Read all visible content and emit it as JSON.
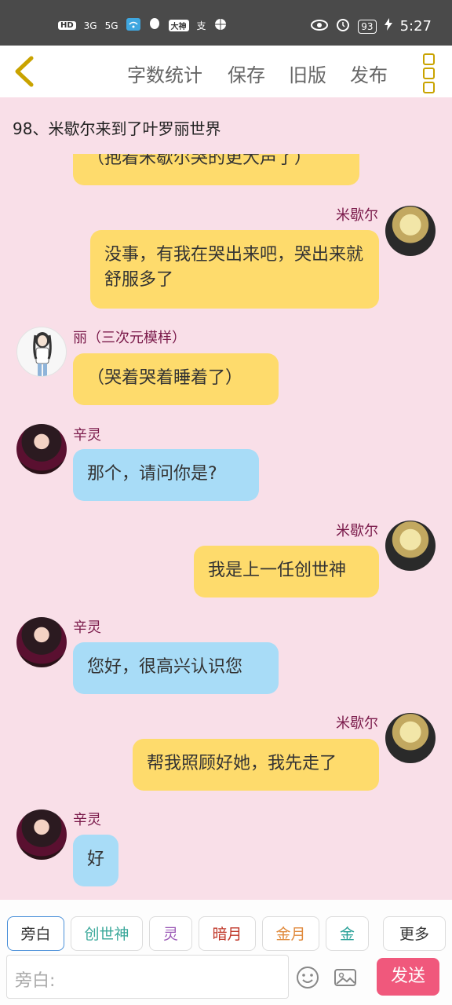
{
  "statusbar": {
    "left_labels": [
      "HD",
      "3G",
      "5G",
      "大神",
      "支"
    ],
    "battery": "93",
    "time": "5:27"
  },
  "topbar": {
    "nav": [
      "字数统计",
      "保存",
      "旧版",
      "发布"
    ]
  },
  "chapter_title": "98、米歇尔来到了叶罗丽世界",
  "messages": [
    {
      "side": "left",
      "speaker": "",
      "text": "（抱着米歇尔哭的更大声了）",
      "color": "yellow"
    },
    {
      "side": "right",
      "speaker": "米歇尔",
      "text": "没事，有我在哭出来吧，哭出来就舒服多了",
      "color": "yellow"
    },
    {
      "side": "left",
      "speaker": "丽（三次元模样）",
      "text": "（哭着哭着睡着了）",
      "color": "yellow"
    },
    {
      "side": "left",
      "speaker": "辛灵",
      "text": "那个，请问你是?",
      "color": "blue"
    },
    {
      "side": "right",
      "speaker": "米歇尔",
      "text": "我是上一任创世神",
      "color": "yellow"
    },
    {
      "side": "left",
      "speaker": "辛灵",
      "text": "您好，很高兴认识您",
      "color": "blue"
    },
    {
      "side": "right",
      "speaker": "米歇尔",
      "text": "帮我照顾好她，我先走了",
      "color": "yellow"
    },
    {
      "side": "left",
      "speaker": "辛灵",
      "text": "好",
      "color": "blue"
    }
  ],
  "roles": [
    {
      "label": "旁白",
      "color": "#333333"
    },
    {
      "label": "创世神",
      "color": "#3aa89a"
    },
    {
      "label": "灵",
      "color": "#9b59b6"
    },
    {
      "label": "暗月",
      "color": "#c0392b"
    },
    {
      "label": "金月",
      "color": "#e08a3c"
    },
    {
      "label": "金",
      "color": "#2aa198"
    }
  ],
  "more_label": "更多",
  "input": {
    "placeholder": "旁白:"
  },
  "send_label": "发送"
}
